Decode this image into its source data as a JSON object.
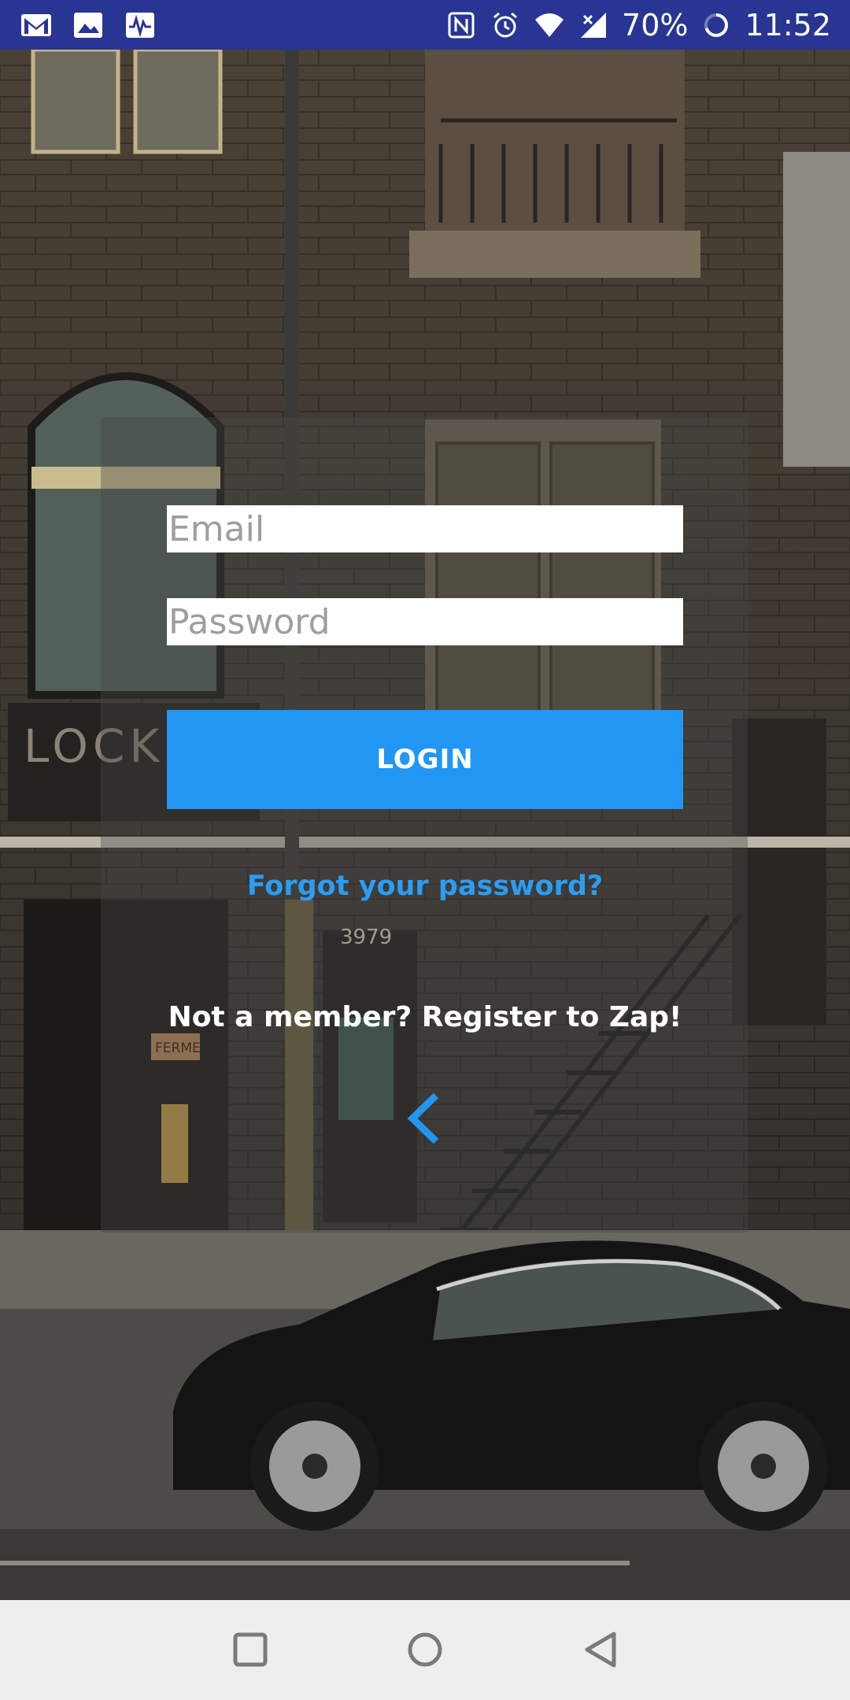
{
  "status_bar": {
    "battery": "70%",
    "time": "11:52",
    "left_icons": [
      "gmail-icon",
      "gallery-icon",
      "pulse-icon"
    ],
    "right_icons": [
      "nfc-icon",
      "alarm-icon",
      "wifi-icon",
      "signal-icon",
      "battery-icon"
    ]
  },
  "login": {
    "email_placeholder": "Email",
    "email_value": "",
    "password_placeholder": "Password",
    "password_value": "",
    "login_label": "LOGIN",
    "forgot_label": "Forgot your password?",
    "register_label": "Not a member? Register to Zap!",
    "back_icon": "chevron-left-icon"
  },
  "background": {
    "sign_text": "LOCKHA",
    "address_number": "3979",
    "door_sign": "FERME"
  },
  "nav_bar": {
    "icons": [
      "recent-apps-icon",
      "home-icon",
      "back-icon"
    ]
  },
  "colors": {
    "status_bar": "#283593",
    "accent": "#2196f3",
    "link": "#2a9df4",
    "nav_bar": "#eeeeee"
  }
}
